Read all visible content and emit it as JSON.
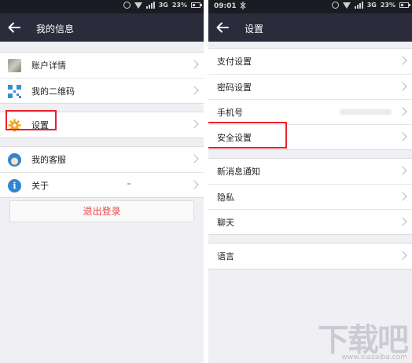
{
  "left": {
    "statusbar": {
      "network": "3G",
      "battery": "23%"
    },
    "navbar": {
      "title": "我的信息"
    },
    "groups": [
      {
        "items": [
          {
            "label": "账户详情",
            "icon": "avatar-icon"
          },
          {
            "label": "我的二维码",
            "icon": "qr-code-icon"
          }
        ]
      },
      {
        "items": [
          {
            "label": "设置",
            "icon": "gear-icon"
          }
        ]
      },
      {
        "items": [
          {
            "label": "我的客服",
            "icon": "customer-service-icon"
          },
          {
            "label": "关于",
            "icon": "info-icon"
          }
        ]
      }
    ],
    "logout_label": "退出登录"
  },
  "right": {
    "statusbar": {
      "time": "09:01",
      "network": "3G",
      "battery": "23%"
    },
    "navbar": {
      "title": "设置"
    },
    "groups": [
      {
        "items": [
          {
            "label": "支付设置"
          },
          {
            "label": "密码设置"
          },
          {
            "label": "手机号"
          },
          {
            "label": "安全设置"
          }
        ]
      },
      {
        "items": [
          {
            "label": "新消息通知"
          },
          {
            "label": "隐私"
          },
          {
            "label": "聊天"
          }
        ]
      },
      {
        "items": [
          {
            "label": "语言"
          }
        ]
      }
    ]
  },
  "colors": {
    "navbar": "#2a2c3c",
    "highlight": "#e8232a",
    "logout_text": "#e8464a",
    "icon_blue": "#2f86d0",
    "gear_orange": "#f5a623"
  },
  "watermark": {
    "text": "下载吧",
    "sub": "www.xiazaiba.com"
  }
}
